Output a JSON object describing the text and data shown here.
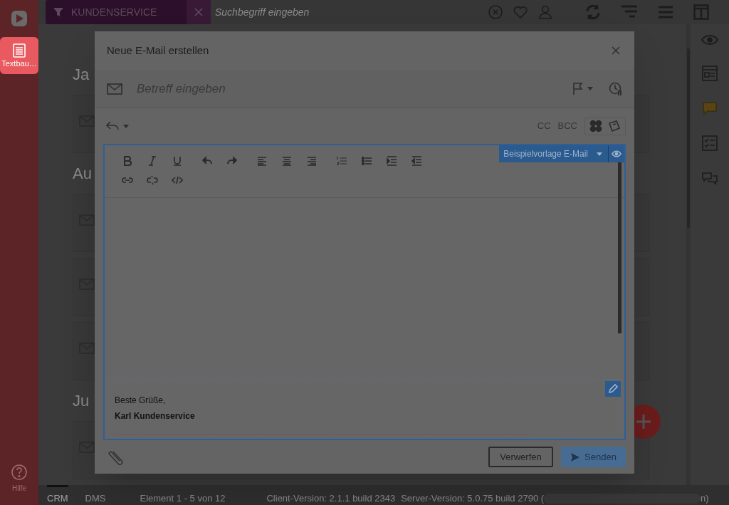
{
  "sidebar": {
    "items": [
      {
        "label": "Textbau…",
        "selected": true,
        "kind": "textblocks"
      }
    ],
    "help": {
      "label": "Hilfe"
    }
  },
  "topbar": {
    "filter": {
      "label": "KUNDENSERVICE"
    },
    "search": {
      "placeholder": "Suchbegriff eingeben"
    }
  },
  "background": {
    "sections": [
      {
        "heading": "Ja",
        "cards": [
          {
            "kind": "email"
          }
        ]
      },
      {
        "heading": "Au",
        "cards": [
          {
            "kind": "email"
          },
          {
            "kind": "email"
          },
          {
            "kind": "email"
          }
        ]
      },
      {
        "heading": "Ju",
        "cards": [
          {
            "kind": "email"
          }
        ]
      }
    ]
  },
  "dialog": {
    "title": "Neue E-Mail erstellen",
    "subject": {
      "placeholder": "Betreff eingeben"
    },
    "recipients": [
      "CC",
      "BCC"
    ],
    "template": {
      "label": "Beispielvorlage E-Mail"
    },
    "signature": {
      "greeting": "Beste Grüße,",
      "name": "Karl Kundenservice"
    },
    "buttons": [
      {
        "label": "Verwerfen",
        "kind": "secondary",
        "disabled": false
      },
      {
        "label": "Senden",
        "kind": "primary",
        "disabled": true
      }
    ]
  },
  "status_bar": {
    "tabs": [
      {
        "label": "CRM",
        "selected": true
      },
      {
        "label": "DMS",
        "selected": false
      }
    ],
    "paging": "Element 1 - 5 von 12",
    "client_version": "Client-Version: 2.1.1 build 2343",
    "server_version": "Server-Version: 5.0.75 build 2790 (",
    "server_version_end": "n)"
  }
}
